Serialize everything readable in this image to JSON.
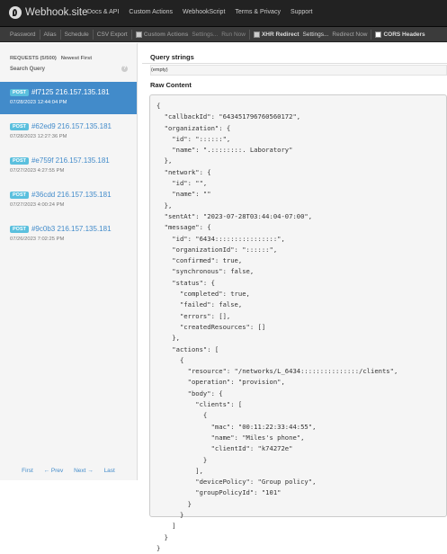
{
  "navbar": {
    "brand": "Webhook.site",
    "links": [
      "Docs & API",
      "Custom Actions",
      "WebhookScript",
      "Terms & Privacy",
      "Support"
    ]
  },
  "toolbar": {
    "password": "Password",
    "alias": "Alias",
    "schedule": "Schedule",
    "csv_export": "CSV Export",
    "custom_actions": "Custom Actions",
    "custom_settings": "Settings...",
    "run_now": "Run Now",
    "xhr_redirect": "XHR Redirect",
    "xhr_settings": "Settings...",
    "redirect_now": "Redirect Now",
    "cors_headers": "CORS Headers"
  },
  "sidebar": {
    "requests_label": "REQUESTS (5/500)",
    "sort_label": "Newest First",
    "search_label": "Search Query",
    "help": "?",
    "requests": [
      {
        "method": "POST",
        "title": "#f7125 216.157.135.181",
        "date": "07/28/2023 12:44:04 PM"
      },
      {
        "method": "POST",
        "title": "#62ed9 216.157.135.181",
        "date": "07/28/2023 12:27:36 PM"
      },
      {
        "method": "POST",
        "title": "#e759f 216.157.135.181",
        "date": "07/27/2023 4:27:55 PM"
      },
      {
        "method": "POST",
        "title": "#36cdd 216.157.135.181",
        "date": "07/27/2023 4:00:24 PM"
      },
      {
        "method": "POST",
        "title": "#9c0b3 216.157.135.181",
        "date": "07/26/2023 7:02:25 PM"
      }
    ],
    "pager": {
      "first": "First",
      "prev": "← Prev",
      "next": "Next →",
      "last": "Last"
    }
  },
  "main": {
    "query_strings_title": "Query strings",
    "query_strings_value": "(empty)",
    "raw_content_title": "Raw Content",
    "raw_content": "{\n  \"callbackId\": \"643451796760560172\",\n  \"organization\": {\n    \"id\": \"::::::\",\n    \"name\": \".::::::::. Laboratory\"\n  },\n  \"network\": {\n    \"id\": \"\",\n    \"name\": \"\"\n  },\n  \"sentAt\": \"2023-07-28T03:44:04-07:00\",\n  \"message\": {\n    \"id\": \"6434::::::::::::::::\",\n    \"organizationId\": \"::::::\",\n    \"confirmed\": true,\n    \"synchronous\": false,\n    \"status\": {\n      \"completed\": true,\n      \"failed\": false,\n      \"errors\": [],\n      \"createdResources\": []\n    },\n    \"actions\": [\n      {\n        \"resource\": \"/networks/L_6434:::::::::::::::/clients\",\n        \"operation\": \"provision\",\n        \"body\": {\n          \"clients\": [\n            {\n              \"mac\": \"00:11:22:33:44:55\",\n              \"name\": \"Miles's phone\",\n              \"clientId\": \"k74272e\"\n            }\n          ],\n          \"devicePolicy\": \"Group policy\",\n          \"groupPolicyId\": \"101\"\n        }\n      }\n    ]\n  }\n}"
  }
}
